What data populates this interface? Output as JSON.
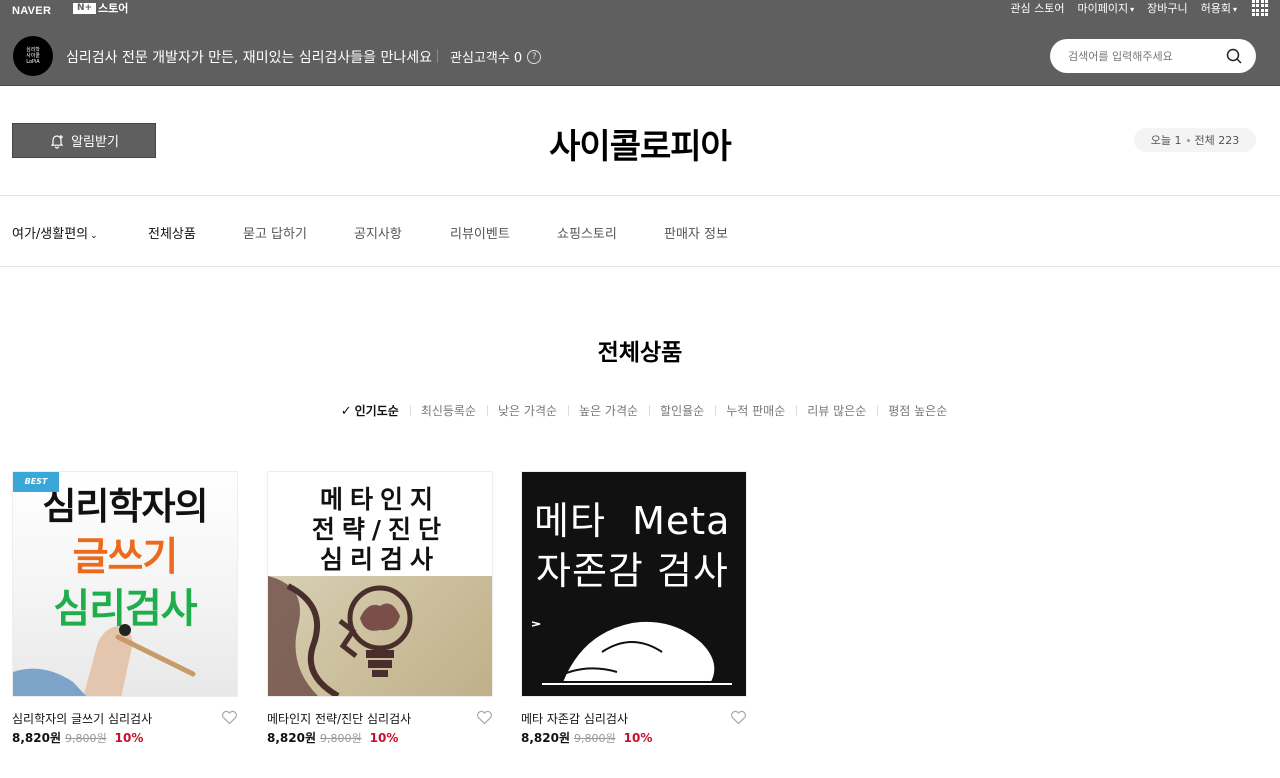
{
  "gnb": {
    "naver": "NAVER",
    "store_badge": "N+",
    "store": "스토어",
    "links": [
      "관심 스토어",
      "마이페이지",
      "장바구니",
      "허용회"
    ]
  },
  "store_header": {
    "profile_lines": [
      "심리학",
      "사이콜",
      "LoPiA"
    ],
    "description": "심리검사 전문 개발자가 만든, 재미있는 심리검사들을 만나세요",
    "fans_label": "관심고객수 0",
    "help": "?",
    "search_placeholder": "검색어를 입력해주세요"
  },
  "title_area": {
    "alarm_label": "알림받기",
    "store_name": "사이콜로피아",
    "today": "오늘 1",
    "total": "전체 223"
  },
  "nav": {
    "category": "여가/생활편의",
    "items": [
      "전체상품",
      "묻고 답하기",
      "공지사항",
      "리뷰이벤트",
      "쇼핑스토리",
      "판매자 정보"
    ]
  },
  "section": {
    "title": "전체상품",
    "sort_options": [
      "인기도순",
      "최신등록순",
      "낮은 가격순",
      "높은 가격순",
      "할인율순",
      "누적 판매순",
      "리뷰 많은순",
      "평점 높은순"
    ]
  },
  "products": [
    {
      "name": "심리학자의 글쓰기 심리검사",
      "price": "8,820원",
      "original": "9,800원",
      "discount": "10%",
      "badge": "BEST",
      "thumb_lines": [
        "심리학자의",
        "글쓰기",
        "심리검사"
      ]
    },
    {
      "name": "메타인지 전략/진단 심리검사",
      "price": "8,820원",
      "original": "9,800원",
      "discount": "10%",
      "thumb_lines": [
        "메타인지",
        "전략/진단",
        "심리검사"
      ]
    },
    {
      "name": "메타 자존감 심리검사",
      "price": "8,820원",
      "original": "9,800원",
      "discount": "10%",
      "thumb_lines": [
        "메타  Meta",
        "자존감 검사"
      ]
    }
  ],
  "colors": {
    "header_bg": "#5f5f5f",
    "discount": "#c8102e",
    "best_badge": "#39a8d8",
    "thumb_orange": "#ec6a1c",
    "thumb_green": "#1fae4b"
  }
}
